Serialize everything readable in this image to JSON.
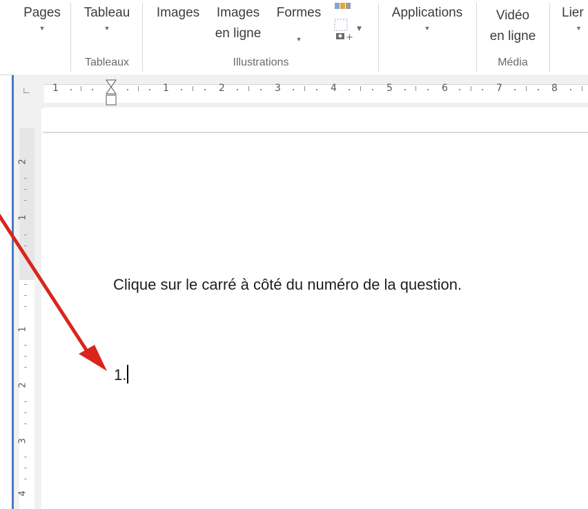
{
  "ribbon": {
    "buttons": {
      "pages": "Pages",
      "tableau": "Tableau",
      "images": "Images",
      "images_en_ligne_1": "Images",
      "images_en_ligne_2": "en ligne",
      "formes": "Formes",
      "applications": "Applications",
      "video_1": "Vidéo",
      "video_2": "en ligne",
      "liens": "Lier"
    },
    "groups": {
      "tableaux": "Tableaux",
      "illustrations": "Illustrations",
      "media": "Média"
    }
  },
  "ruler": {
    "horizontal_numbers": [
      "1",
      "1",
      "2",
      "3",
      "4",
      "5",
      "6",
      "7",
      "8"
    ],
    "vertical_numbers": [
      "2",
      "1",
      "1",
      "2",
      "3",
      "4"
    ]
  },
  "document": {
    "instruction": "Clique sur le carré à côté du numéro de la question.",
    "list_number": "1."
  },
  "colors": {
    "annotation_arrow": "#d9251c",
    "accent_border": "#4a78c2"
  }
}
